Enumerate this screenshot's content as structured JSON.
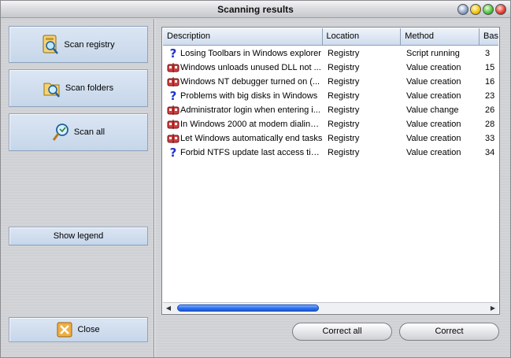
{
  "window": {
    "title": "Scanning results"
  },
  "sidebar": {
    "scan_registry": "Scan registry",
    "scan_folders": "Scan folders",
    "scan_all": "Scan all",
    "show_legend": "Show legend",
    "close": "Close"
  },
  "table": {
    "columns": [
      "Description",
      "Location",
      "Method",
      "Bas"
    ],
    "rows": [
      {
        "icon": "question-icon",
        "description": "Losing Toolbars in Windows explorer",
        "location": "Registry",
        "method": "Script running",
        "base": "3"
      },
      {
        "icon": "bug-icon",
        "description": "Windows unloads unused DLL not ...",
        "location": "Registry",
        "method": "Value creation",
        "base": "15"
      },
      {
        "icon": "bug-icon",
        "description": "Windows NT debugger turned on (...",
        "location": "Registry",
        "method": "Value creation",
        "base": "16"
      },
      {
        "icon": "question-icon",
        "description": "Problems with big disks in Windows",
        "location": "Registry",
        "method": "Value creation",
        "base": "23"
      },
      {
        "icon": "bug-icon",
        "description": "Administrator login when entering i...",
        "location": "Registry",
        "method": "Value change",
        "base": "26"
      },
      {
        "icon": "bug-icon",
        "description": "In Windows 2000 at modem dialing ...",
        "location": "Registry",
        "method": "Value creation",
        "base": "28"
      },
      {
        "icon": "bug-icon",
        "description": "Let Windows automatically end tasks",
        "location": "Registry",
        "method": "Value creation",
        "base": "33"
      },
      {
        "icon": "question-icon",
        "description": "Forbid NTFS update last access tim...",
        "location": "Registry",
        "method": "Value creation",
        "base": "34"
      }
    ]
  },
  "buttons": {
    "correct_all": "Correct all",
    "correct": "Correct"
  },
  "colors": {
    "accent": "#2a6ff0",
    "side_button": "#c6d6ea",
    "question": "#2233cc",
    "bug": "#b0202a"
  }
}
